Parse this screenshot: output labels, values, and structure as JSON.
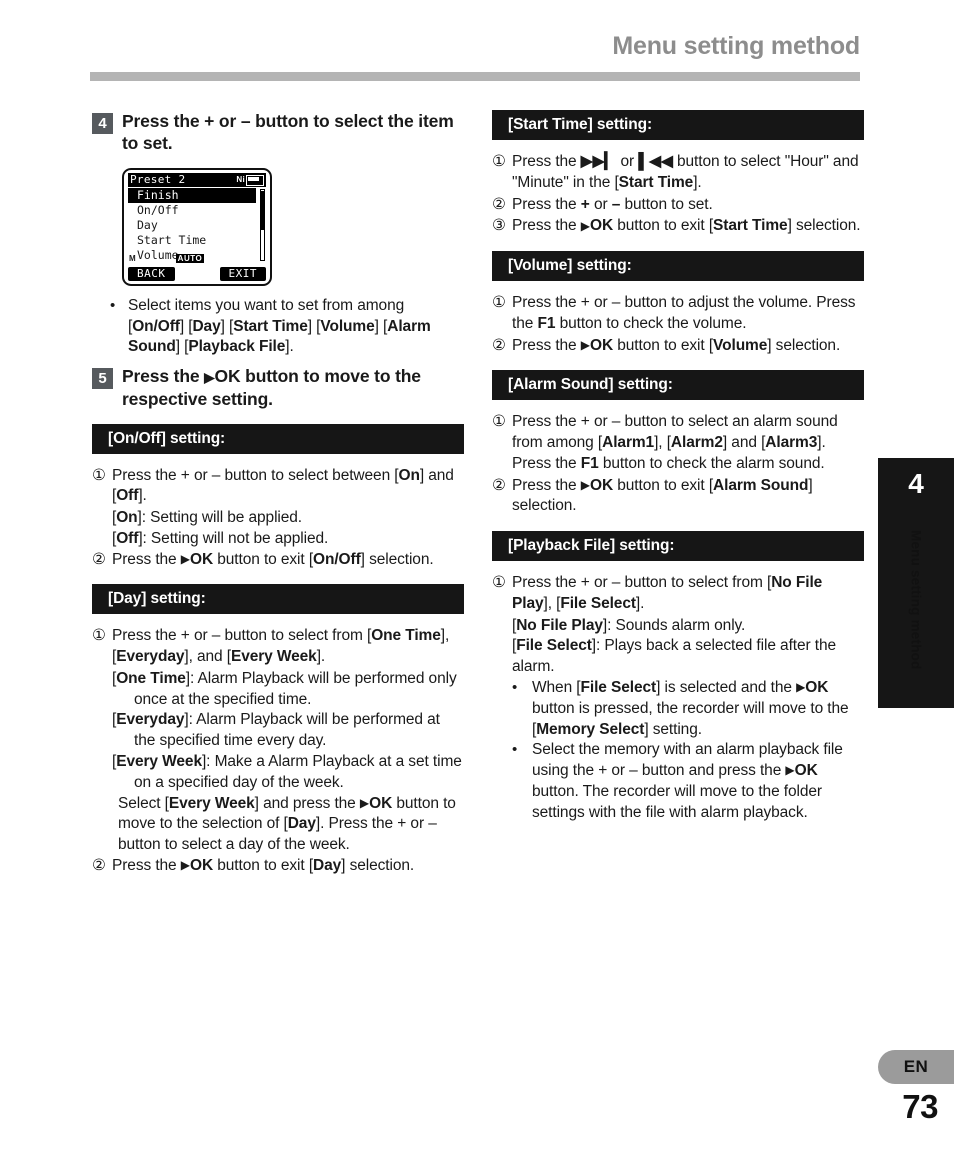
{
  "header": {
    "title": "Menu setting method"
  },
  "steps": {
    "step4": {
      "number": "4",
      "text": "Press the + or – button to select the item to set."
    },
    "step5": {
      "number": "5",
      "text_before": "Press the ",
      "ok": "OK",
      "text_after": " button to move to the respective setting."
    }
  },
  "lcd": {
    "title": "Preset 2",
    "battery_label": "Ni",
    "battery_icon": "battery-icon",
    "items": [
      {
        "label": "Finish",
        "selected": true
      },
      {
        "label": "On/Off",
        "selected": false
      },
      {
        "label": "Day",
        "selected": false
      },
      {
        "label": "Start Time",
        "selected": false
      },
      {
        "label": "Volume",
        "selected": false
      }
    ],
    "mic_indicator": "M",
    "auto_indicator": "AUTO",
    "softkey_left": "BACK",
    "softkey_right": "EXIT"
  },
  "note_step4": {
    "bullet": "•",
    "line1": "Select items you want to set from",
    "line2_pre": "among [",
    "items": [
      "On/Off",
      "Day",
      "Start Time",
      "Volume",
      "Alarm Sound",
      "Playback File"
    ]
  },
  "sections": {
    "onoff": {
      "heading_item": "On/Off",
      "heading_suffix": "] setting:",
      "heading_prefix": "[",
      "items": [
        {
          "num": "①",
          "text": "Press the + or – button to select between [On] and [Off]."
        },
        {
          "num": "②",
          "text": "Press the ▶OK button to exit [On/Off] selection."
        }
      ],
      "sub1": "[On]: Setting will be applied.",
      "sub2": "[Off]: Setting will not be applied."
    },
    "day": {
      "heading_item": "Day",
      "items": [
        {
          "num": "①",
          "text": "Press the + or – button to select from [One Time], [Everyday], and [Every Week]."
        },
        {
          "num": "②",
          "text": "Press the ▶OK button to exit [Day] selection."
        }
      ],
      "desc_one_time": "[One Time]: Alarm Playback will be performed only once at the specified time.",
      "desc_everyday": "[Everyday]: Alarm Playback will be performed at the specified time every day.",
      "desc_every_week": "[Every Week]: Make a Alarm Playback at a set time on a specified day of the week.",
      "desc_select": "Select [Every Week] and press the ▶OK button to move to the selection of [Day]. Press the + or – button to select a day of the week."
    },
    "start_time": {
      "heading_item": "Start Time",
      "items": [
        {
          "num": "①",
          "text": "Press the ▶▶I or I◀◀ button to select \"Hour\" and \"Minute\" in the [Start Time]."
        },
        {
          "num": "②",
          "text": "Press the + or – button to set."
        },
        {
          "num": "③",
          "text": "Press the ▶OK button to exit [Start Time] selection."
        }
      ]
    },
    "volume": {
      "heading_item": "Volume",
      "items": [
        {
          "num": "①",
          "text": "Press the + or – button to adjust the volume. Press the F1 button to check the volume."
        },
        {
          "num": "②",
          "text": "Press the ▶OK button to exit [Volume] selection."
        }
      ]
    },
    "alarm_sound": {
      "heading_item": "Alarm Sound",
      "items": [
        {
          "num": "①",
          "text": "Press the + or – button to select an alarm sound from among [Alarm1], [Alarm2] and [Alarm3]. Press the F1 button to check the alarm sound."
        },
        {
          "num": "②",
          "text": "Press the ▶OK button to exit [Alarm Sound] selection."
        }
      ]
    },
    "playback_file": {
      "heading_item": "Playback File",
      "items": [
        {
          "num": "①",
          "text": "Press the + or – button to select from [No File Play], [File Select]."
        }
      ],
      "sub_no_file": "[No File Play]: Sounds alarm only.",
      "sub_file_select": "[File Select]: Plays back a selected file after the alarm.",
      "bullet1": "When [File Select] is selected and the ▶OK button is pressed, the recorder will move to the [Memory Select] setting.",
      "bullet2": "Select the memory with an alarm playback file using the + or – button and press the ▶OK button. The recorder will move to the folder settings with the file with alarm playback."
    }
  },
  "side_tab": {
    "chapter": "4",
    "label": "Menu setting method"
  },
  "footer": {
    "language": "EN",
    "page_number": "73"
  },
  "colors": {
    "header_gray": "#8d8d8d",
    "rule_gray": "#b4b4b4",
    "section_black": "#161616",
    "badge_gray": "#565a5e",
    "pill_gray": "#9b9b9b"
  }
}
